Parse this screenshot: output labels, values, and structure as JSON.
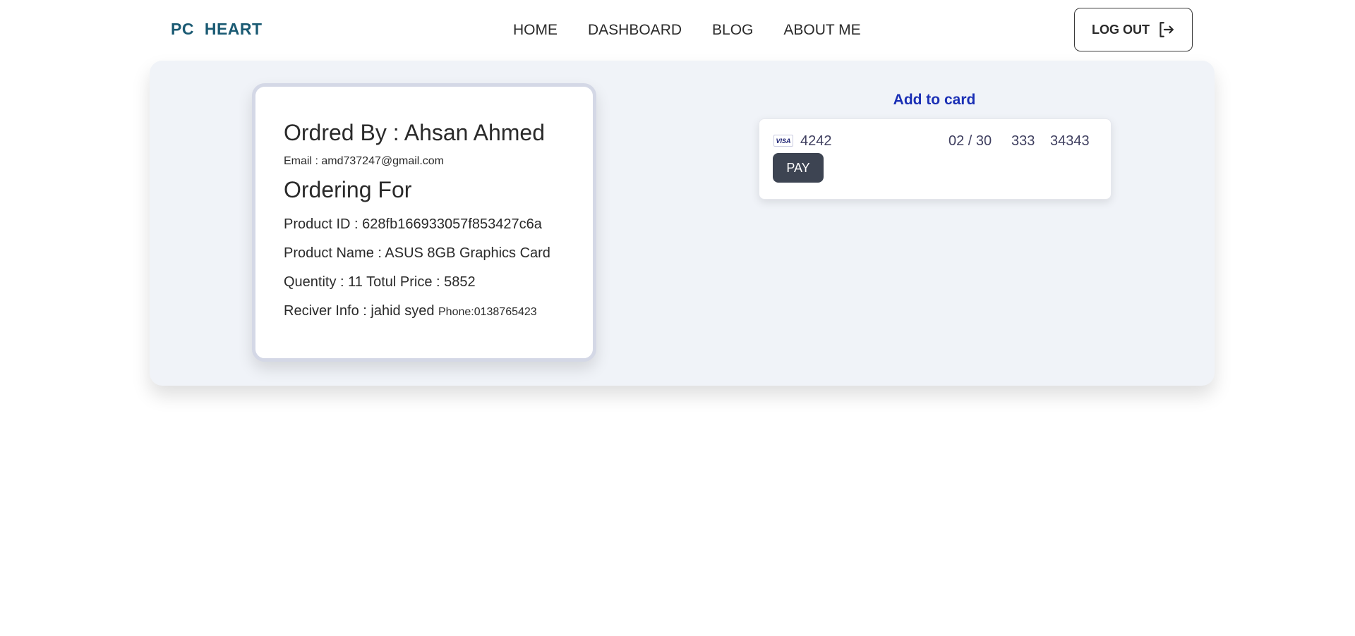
{
  "navbar": {
    "logo": "PC  HEART",
    "links": [
      "HOME",
      "DASHBOARD",
      "BLOG",
      "ABOUT ME"
    ],
    "logout_label": "LOG OUT"
  },
  "order": {
    "ordered_by": "Ordred By : Ahsan Ahmed",
    "email": "Email : amd737247@gmail.com",
    "ordering_for": "Ordering For",
    "product_id": "Product ID : 628fb166933057f853427c6a",
    "product_name": "Product Name : ASUS 8GB Graphics Card",
    "quantity_price": "Quentity : 11 Totul Price : 5852",
    "receiver": "Reciver Info : jahid syed",
    "phone": "Phone:0138765423"
  },
  "payment": {
    "title": "Add to card",
    "card_brand": "VISA",
    "card_number": "4242",
    "expiry": "02 / 30",
    "cvc": "333",
    "zip": "34343",
    "pay_label": "PAY"
  },
  "colors": {
    "logo": "#1a5a73",
    "panel_bg": "#f0f3f8",
    "payment_title": "#1a2fb5",
    "pay_button": "#3d4452"
  }
}
